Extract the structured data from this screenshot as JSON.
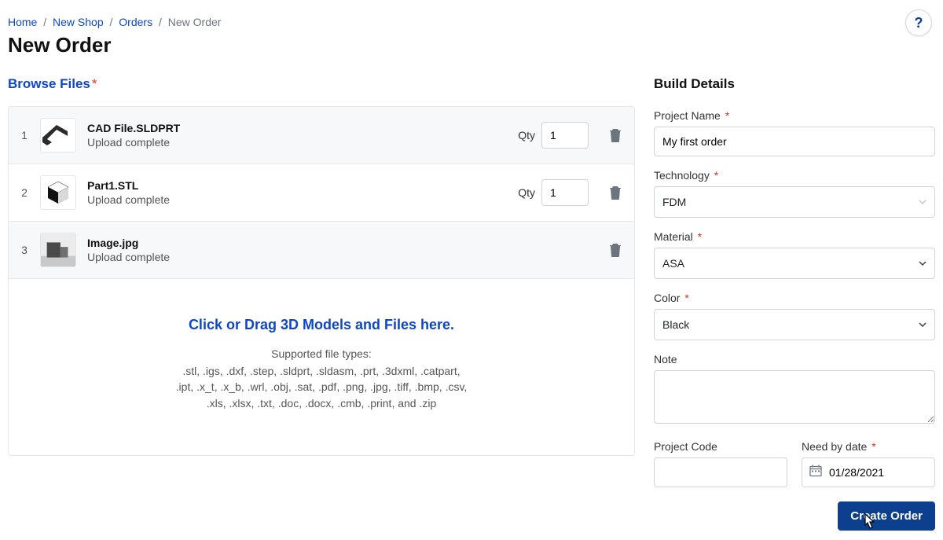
{
  "breadcrumb": {
    "home": "Home",
    "shop": "New Shop",
    "orders": "Orders",
    "current": "New Order"
  },
  "page_title": "New Order",
  "browse": {
    "label": "Browse Files",
    "qty_label": "Qty",
    "rows": [
      {
        "index": "1",
        "name": "CAD File.SLDPRT",
        "status": "Upload complete",
        "qty": "1"
      },
      {
        "index": "2",
        "name": "Part1.STL",
        "status": "Upload complete",
        "qty": "1"
      },
      {
        "index": "3",
        "name": "Image.jpg",
        "status": "Upload complete"
      }
    ],
    "dropzone": {
      "headline": "Click or Drag 3D Models and Files here.",
      "supported_label": "Supported file types:",
      "types_line1": ".stl, .igs, .dxf, .step, .sldprt, .sldasm, .prt, .3dxml, .catpart,",
      "types_line2": ".ipt, .x_t, .x_b, .wrl, .obj, .sat, .pdf, .png, .jpg, .tiff, .bmp, .csv,",
      "types_line3": ".xls, .xlsx, .txt, .doc, .docx, .cmb, .print, and .zip"
    }
  },
  "details": {
    "title": "Build Details",
    "project_name": {
      "label": "Project Name",
      "value": "My first order"
    },
    "technology": {
      "label": "Technology",
      "value": "FDM"
    },
    "material": {
      "label": "Material",
      "value": "ASA"
    },
    "color": {
      "label": "Color",
      "value": "Black"
    },
    "note": {
      "label": "Note",
      "value": ""
    },
    "project_code": {
      "label": "Project Code",
      "value": ""
    },
    "need_by": {
      "label": "Need by date",
      "value": "01/28/2021"
    },
    "submit": "Create Order"
  },
  "help": "?"
}
